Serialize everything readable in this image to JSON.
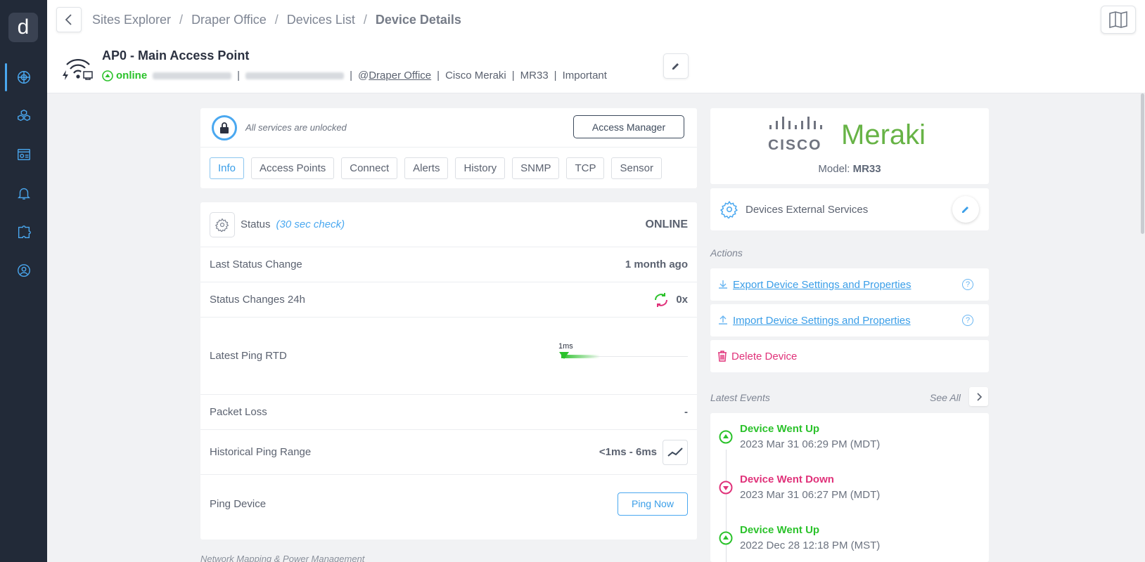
{
  "sidebar": {
    "logo": "d",
    "items": [
      {
        "icon": "globe-icon",
        "active": true
      },
      {
        "icon": "cubes-icon",
        "active": false
      },
      {
        "icon": "dashboard-icon",
        "active": false
      },
      {
        "icon": "bell-icon",
        "active": false
      },
      {
        "icon": "puzzle-icon",
        "active": false
      },
      {
        "icon": "support-icon",
        "active": false
      }
    ]
  },
  "breadcrumb": {
    "items": [
      "Sites Explorer",
      "Draper Office",
      "Devices List"
    ],
    "separator": "/",
    "current": "Device Details"
  },
  "device": {
    "title": "AP0 - Main Access Point",
    "status": "online",
    "site": "@Draper Office",
    "site_prefix": "@",
    "site_name": "Draper Office",
    "vendor": "Cisco Meraki",
    "model": "MR33",
    "tag": "Important"
  },
  "services": {
    "lock_text": "All services are unlocked",
    "access_manager": "Access Manager",
    "tabs": [
      "Info",
      "Access Points",
      "Connect",
      "Alerts",
      "History",
      "SNMP",
      "TCP",
      "Sensor"
    ],
    "active_tab": "Info"
  },
  "status": {
    "label": "Status",
    "check_note": "(30 sec check)",
    "value": "ONLINE",
    "last_change_label": "Last Status Change",
    "last_change_value": "1 month ago",
    "changes_label": "Status Changes 24h",
    "changes_value": "0x",
    "ping_label": "Latest Ping RTD",
    "ping_value": "1ms",
    "ping_level": 0.0,
    "loss_label": "Packet Loss",
    "loss_value": "-",
    "range_label": "Historical Ping Range",
    "range_value": "<1ms - 6ms",
    "ping_device_label": "Ping Device",
    "ping_now": "Ping Now",
    "next_section": "Network Mapping & Power Management"
  },
  "brand": {
    "cisco": "CISCO",
    "meraki": "Meraki",
    "model_label": "Model:",
    "model_value": "MR33"
  },
  "external": {
    "label": "Devices External Services"
  },
  "actions": {
    "heading": "Actions",
    "export": "Export Device Settings and Properties",
    "import": "Import Device Settings and Properties",
    "help": "?",
    "delete": "Delete Device"
  },
  "events": {
    "heading": "Latest Events",
    "see_all": "See All",
    "items": [
      {
        "title": "Device Went Up",
        "time": "2023 Mar 31 06:29 PM (MDT)",
        "type": "up"
      },
      {
        "title": "Device Went Down",
        "time": "2023 Mar 31 06:27 PM (MDT)",
        "type": "down"
      },
      {
        "title": "Device Went Up",
        "time": "2022 Dec 28 12:18 PM (MST)",
        "type": "up"
      }
    ]
  },
  "colors": {
    "accent": "#3a9ee8",
    "online": "#2bc22b",
    "danger": "#e0327a",
    "sidebar": "#222a38",
    "meraki": "#67b346"
  }
}
